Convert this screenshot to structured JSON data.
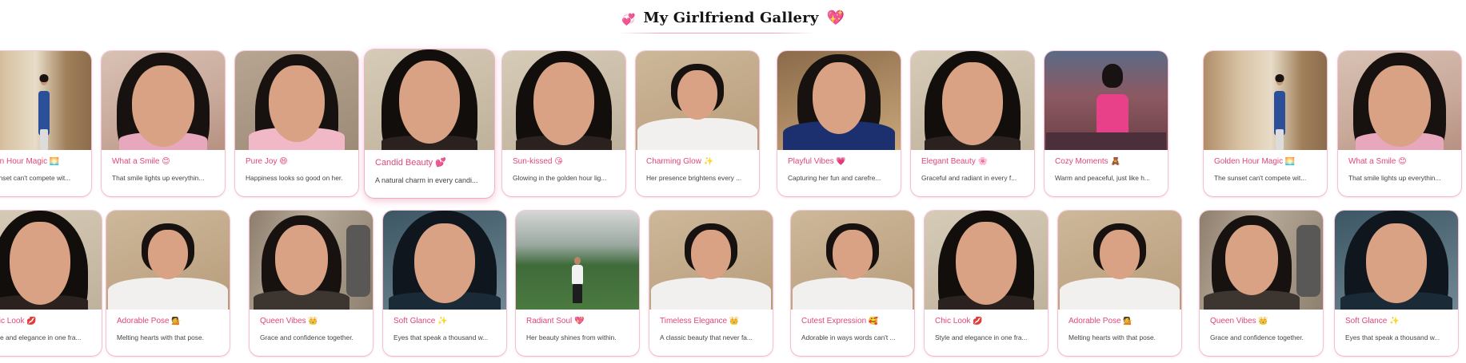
{
  "header": {
    "title": "My Girlfriend Gallery",
    "left_icon": "💞",
    "right_icon": "💖"
  },
  "rows": [
    {
      "cards": [
        {
          "title": "Golden Hour Magic 🌅",
          "desc": "The sunset can't compete wit...",
          "photo": "balcony"
        },
        {
          "title": "What a Smile 😊",
          "desc": "That smile lights up everythin...",
          "photo": "smile"
        },
        {
          "title": "Pure Joy 😄",
          "desc": "Happiness looks so good on her.",
          "photo": "closeup"
        },
        {
          "title": "Candid Beauty 💕",
          "desc": "A natural charm in every candi...",
          "photo": "closeup-dark",
          "featured": true
        },
        {
          "title": "Sun-kissed 😘",
          "desc": "Glowing in the golden hour lig...",
          "photo": "closeup-dark"
        },
        {
          "title": "Charming Glow ✨",
          "desc": "Her presence brightens every ...",
          "photo": "white-shirt"
        },
        {
          "title": "Playful Vibes 💗",
          "desc": "Capturing her fun and carefre...",
          "photo": "blue-shirt"
        },
        {
          "title": "Elegant Beauty 🌸",
          "desc": "Graceful and radiant in every f...",
          "photo": "closeup-dark"
        },
        {
          "title": "Cozy Moments 🧸",
          "desc": "Warm and peaceful, just like h...",
          "photo": "castle"
        },
        {
          "title": "Golden Hour Magic 🌅",
          "desc": "The sunset can't compete wit...",
          "photo": "balcony"
        },
        {
          "title": "What a Smile 😊",
          "desc": "That smile lights up everythin...",
          "photo": "smile"
        }
      ]
    },
    {
      "cards": [
        {
          "title": "Chic Look 💋",
          "desc": "Style and elegance in one fra...",
          "photo": "closeup-dark"
        },
        {
          "title": "Adorable Pose 💁",
          "desc": "Melting hearts with that pose.",
          "photo": "white-shirt"
        },
        {
          "title": "Queen Vibes 👑",
          "desc": "Grace and confidence together.",
          "photo": "phone"
        },
        {
          "title": "Soft Glance ✨",
          "desc": "Eyes that speak a thousand w...",
          "photo": "glance"
        },
        {
          "title": "Radiant Soul 💖",
          "desc": "Her beauty shines from within.",
          "photo": "outdoor"
        },
        {
          "title": "Timeless Elegance 👑",
          "desc": "A classic beauty that never fa...",
          "photo": "white-shirt"
        },
        {
          "title": "Cutest Expression 🥰",
          "desc": "Adorable in ways words can't ...",
          "photo": "white-shirt"
        },
        {
          "title": "Chic Look 💋",
          "desc": "Style and elegance in one fra...",
          "photo": "closeup-dark"
        },
        {
          "title": "Adorable Pose 💁",
          "desc": "Melting hearts with that pose.",
          "photo": "white-shirt"
        },
        {
          "title": "Queen Vibes 👑",
          "desc": "Grace and confidence together.",
          "photo": "phone"
        },
        {
          "title": "Soft Glance ✨",
          "desc": "Eyes that speak a thousand w...",
          "photo": "glance"
        }
      ]
    }
  ],
  "colors": {
    "accent": "#e0457c",
    "card_border": "#f0b4cb"
  }
}
